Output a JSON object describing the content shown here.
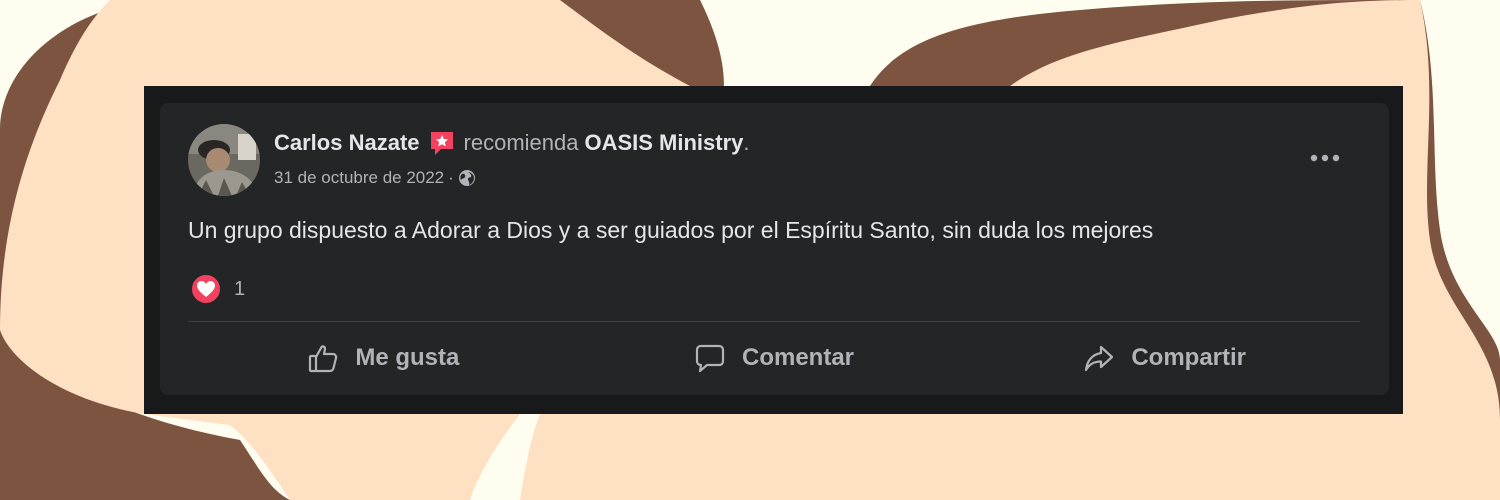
{
  "colors": {
    "background": "#fffdf0",
    "blob_peach": "#fee0c2",
    "blob_brown": "#7c5440",
    "card_bg": "#242526",
    "frame_bg": "#18191a",
    "text_primary": "#e4e6eb",
    "text_secondary": "#b0b3b8",
    "badge_pink": "#f3425f"
  },
  "post": {
    "author": "Carlos Nazate",
    "author_badge_icon": "star-badge-icon",
    "verb": "recomienda",
    "page": "OASIS Ministry",
    "period": ".",
    "date": "31 de octubre de 2022",
    "separator": "·",
    "audience_icon": "globe-icon",
    "more_icon": "more-options-icon",
    "text": "Un grupo dispuesto a Adorar a Dios y a ser guiados por el Espíritu Santo, sin duda los mejores",
    "reaction_icon": "love-heart-icon",
    "reaction_count": "1"
  },
  "actions": {
    "like": {
      "label": "Me gusta",
      "icon": "thumbs-up-icon"
    },
    "comment": {
      "label": "Comentar",
      "icon": "comment-bubble-icon"
    },
    "share": {
      "label": "Compartir",
      "icon": "share-arrow-icon"
    }
  }
}
